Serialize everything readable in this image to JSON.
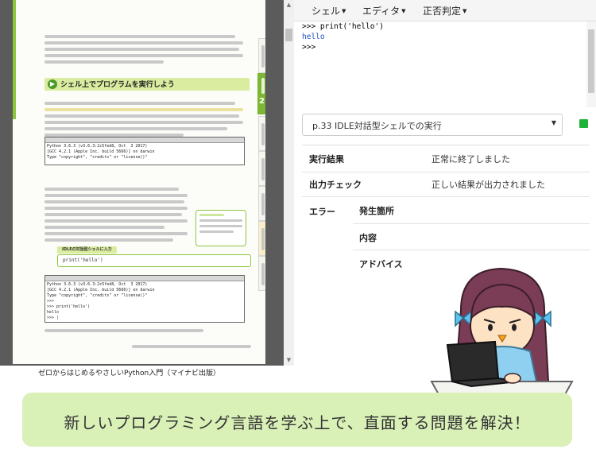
{
  "menubar": {
    "items": [
      {
        "label": "シェル"
      },
      {
        "label": "エディタ"
      },
      {
        "label": "正否判定"
      }
    ]
  },
  "shell": {
    "lines": [
      {
        "text": ">>> print('hello')",
        "kind": "input"
      },
      {
        "text": "hello",
        "kind": "output"
      },
      {
        "text": ">>>",
        "kind": "input"
      }
    ]
  },
  "exercise_select": {
    "value": "p.33 IDLE対話型シェルでの実行"
  },
  "results": {
    "exec_label": "実行結果",
    "exec_value": "正常に終了しました",
    "output_label": "出力チェック",
    "output_value": "正しい結果が出力されました",
    "error_label": "エラー",
    "error_fields": [
      {
        "label": "発生箇所"
      },
      {
        "label": "内容"
      },
      {
        "label": "アドバイス"
      }
    ]
  },
  "book": {
    "section_title": "シェル上でプログラムを実行しよう",
    "chapter_number": "2",
    "idle_box_label": "IDLEの対話型シェルに入力",
    "idle_box_code": "print('hello')",
    "caption": "ゼロからはじめるやさしいPython入門（マイナビ出版）"
  },
  "banner": {
    "text": "新しいプログラミング言語を学ぶ上で、直面する問題を解決！"
  },
  "colors": {
    "accent_green": "#8dc63f",
    "banner_bg": "#d9f0b7",
    "shell_output": "#1f4fbd"
  }
}
